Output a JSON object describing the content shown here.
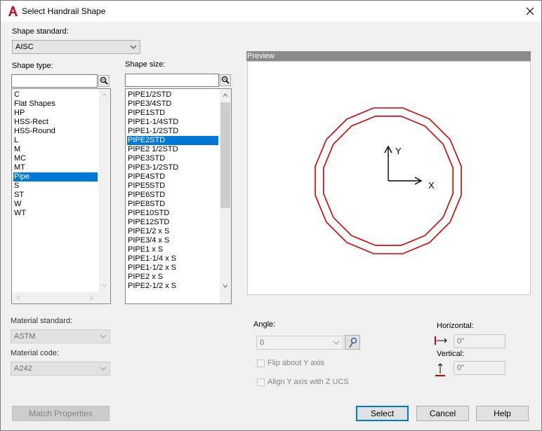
{
  "window": {
    "title": "Select Handrail Shape"
  },
  "shape_standard": {
    "label": "Shape standard:",
    "value": "AISC"
  },
  "shape_type": {
    "label": "Shape type:",
    "search_value": "",
    "items": [
      "C",
      "Flat Shapes",
      "HP",
      "HSS-Rect",
      "HSS-Round",
      "L",
      "M",
      "MC",
      "MT",
      "Pipe",
      "S",
      "ST",
      "W",
      "WT"
    ],
    "selected_index": 9
  },
  "shape_size": {
    "label": "Shape size:",
    "search_value": "",
    "items": [
      "PIPE1/2STD",
      "PIPE3/4STD",
      "PIPE1STD",
      "PIPE1-1/4STD",
      "PIPE1-1/2STD",
      "PIPE2STD",
      "PIPE2 1/2STD",
      "PIPE3STD",
      "PIPE3-1/2STD",
      "PIPE4STD",
      "PIPE5STD",
      "PIPE6STD",
      "PIPE8STD",
      "PIPE10STD",
      "PIPE12STD",
      "PIPE1/2 x S",
      "PIPE3/4 x S",
      "PIPE1 x S",
      "PIPE1-1/4 x S",
      "PIPE1-1/2 x S",
      "PIPE2 x S",
      "PIPE2-1/2 x S"
    ],
    "selected_index": 5
  },
  "preview": {
    "label": "Preview",
    "axis_x": "X",
    "axis_y": "Y",
    "outline_color": "#d40000"
  },
  "material_standard": {
    "label": "Material standard:",
    "value": "ASTM"
  },
  "material_code": {
    "label": "Material code:",
    "value": "A242"
  },
  "angle": {
    "label": "Angle:",
    "value": "0"
  },
  "flip_y": {
    "label": "Flip about Y axis",
    "checked": false
  },
  "align_y": {
    "label": "Align Y axis with Z UCS",
    "checked": false
  },
  "horizontal": {
    "label": "Horizontal:",
    "value": "0\""
  },
  "vertical": {
    "label": "Vertical:",
    "value": "0\""
  },
  "buttons": {
    "match_properties": "Match Properties",
    "select": "Select",
    "cancel": "Cancel",
    "help": "Help"
  },
  "colors": {
    "selection": "#0078d7",
    "accent_red": "#d40000"
  }
}
